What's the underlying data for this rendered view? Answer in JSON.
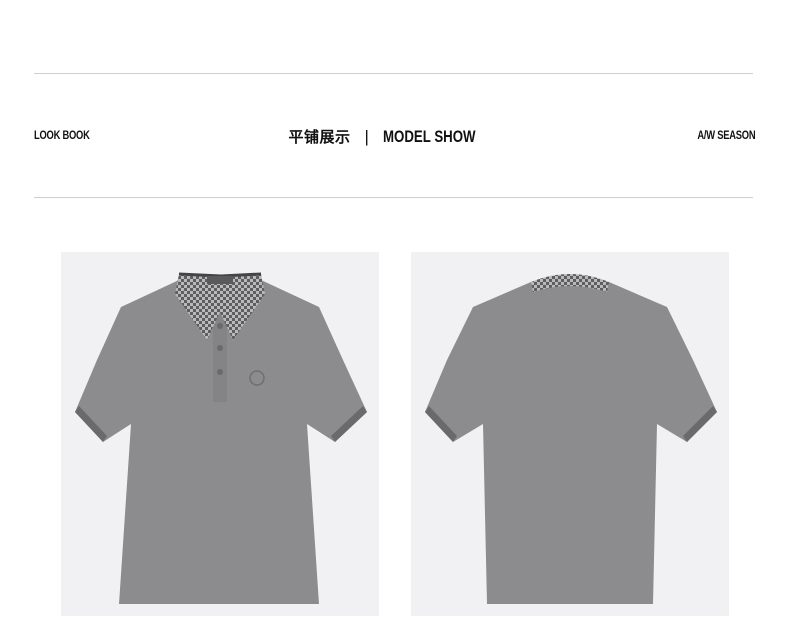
{
  "header": {
    "left_tag": "LOOK BOOK",
    "title_cn": "平铺展示",
    "separator": "|",
    "title_en": "MODEL SHOW",
    "right_tag": "A/W SEASON"
  },
  "products": [
    {
      "view": "front",
      "image": "grey-polo-front"
    },
    {
      "view": "back",
      "image": "grey-polo-back"
    }
  ],
  "colors": {
    "shirt": "#8c8c8e",
    "collar": "#6a6a6c",
    "panel_bg": "#f1f1f3",
    "rule": "#cfcfcf"
  }
}
